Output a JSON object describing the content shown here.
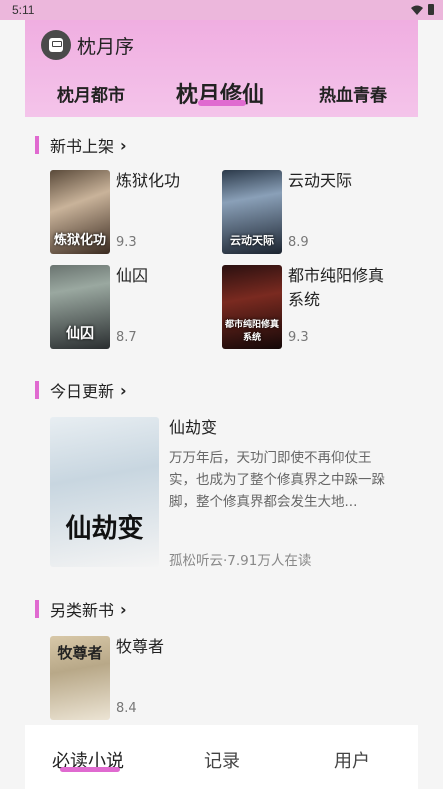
{
  "status_bar": {
    "time": "5:11",
    "wifi_icon": "wifi-icon",
    "battery_icon": "battery-icon"
  },
  "header": {
    "app_title": "枕月序",
    "tabs": [
      {
        "label": "枕月都市",
        "active": false
      },
      {
        "label": "枕月修仙",
        "active": true
      },
      {
        "label": "热血青春",
        "active": false
      }
    ]
  },
  "section_new": {
    "title": "新书上架",
    "books": [
      {
        "title": "炼狱化功",
        "score": "9.3",
        "cover_text": "炼狱化功"
      },
      {
        "title": "云动天际",
        "score": "8.9",
        "cover_text": "云动天际"
      },
      {
        "title": "仙囚",
        "score": "8.7",
        "cover_text": "仙囚"
      },
      {
        "title": "都市纯阳修真系统",
        "score": "9.3",
        "cover_text": "都市纯阳修真系统"
      }
    ]
  },
  "section_today": {
    "title": "今日更新",
    "book": {
      "title": "仙劫变",
      "cover_text": "仙劫变",
      "description": "万万年后，天功门即使不再仰仗王实，也成为了整个修真界之中跺一跺脚，整个修真界都会发生大地...",
      "meta": "孤松听云·7.91万人在读"
    }
  },
  "section_other": {
    "title": "另类新书",
    "books": [
      {
        "title": "牧尊者",
        "score": "8.4",
        "cover_text": "牧尊者"
      }
    ]
  },
  "bottom_nav": [
    {
      "label": "必读小说",
      "active": true
    },
    {
      "label": "记录",
      "active": false
    },
    {
      "label": "用户",
      "active": false
    }
  ],
  "colors": {
    "accent": "#e06ad0",
    "header_bg": "#f2b6e4",
    "background": "#f5f5f5"
  }
}
